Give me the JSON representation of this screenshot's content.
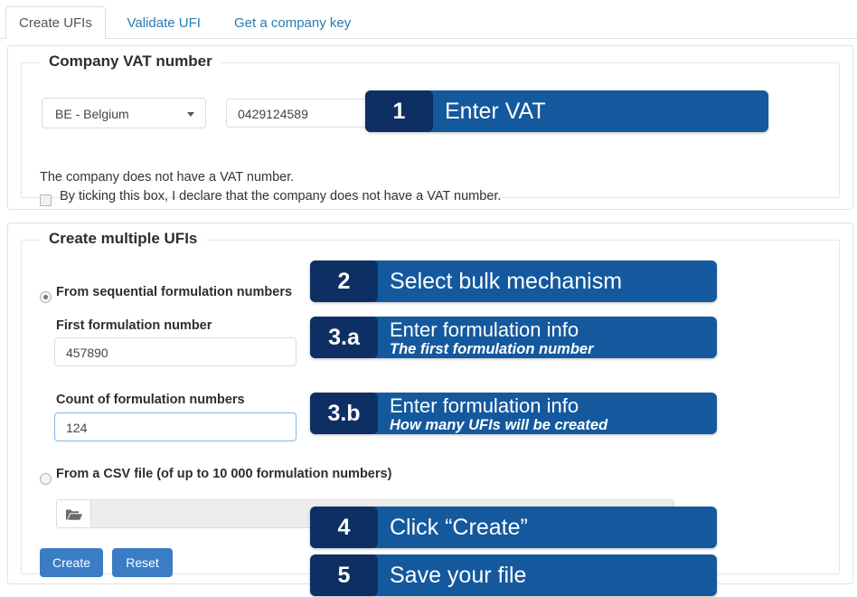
{
  "tabs": [
    {
      "label": "Create UFIs",
      "active": true
    },
    {
      "label": "Validate UFI",
      "active": false
    },
    {
      "label": "Get a company key",
      "active": false
    }
  ],
  "vat_section": {
    "legend": "Company VAT number",
    "country_select": {
      "value": "BE - Belgium",
      "icon": "chevron-down-icon"
    },
    "vat_input": {
      "value": "0429124589",
      "placeholder": ""
    },
    "no_vat_text": "The company does not have a VAT number.",
    "no_vat_checkbox": {
      "label": "By ticking this box, I declare that the company does not have a VAT number.",
      "checked": false
    }
  },
  "bulk_section": {
    "legend": "Create multiple UFIs",
    "radio_sequential": {
      "label": "From sequential formulation numbers",
      "selected": true
    },
    "first_number": {
      "label": "First formulation number",
      "value": "457890",
      "placeholder": "",
      "focused": false
    },
    "count_numbers": {
      "label": "Count of formulation numbers",
      "value": "124",
      "placeholder": "",
      "focused": true
    },
    "radio_csv": {
      "label": "From a CSV file (of up to 10 000 formulation numbers)",
      "selected": false
    },
    "file_picker": {
      "browse_icon": "open-folder-icon",
      "value": "",
      "placeholder": ""
    },
    "create_button": "Create",
    "reset_button": "Reset"
  },
  "callouts": [
    {
      "number": "1",
      "line1": "Enter VAT",
      "line2": ""
    },
    {
      "number": "2",
      "line1": "Select bulk mechanism",
      "line2": ""
    },
    {
      "number": "3.a",
      "line1": "Enter formulation info",
      "line2": "The first formulation number"
    },
    {
      "number": "3.b",
      "line1": "Enter formulation info",
      "line2": "How many UFIs will be created"
    },
    {
      "number": "4",
      "line1": "Click “Create”",
      "line2": ""
    },
    {
      "number": "5",
      "line1": "Save your file",
      "line2": ""
    }
  ],
  "colors": {
    "callout_body": "#14599e",
    "callout_number": "#0d2f63",
    "button_blue": "#3b7dc4",
    "tab_link": "#2a7ab0",
    "focus_border": "#86b7e8"
  }
}
